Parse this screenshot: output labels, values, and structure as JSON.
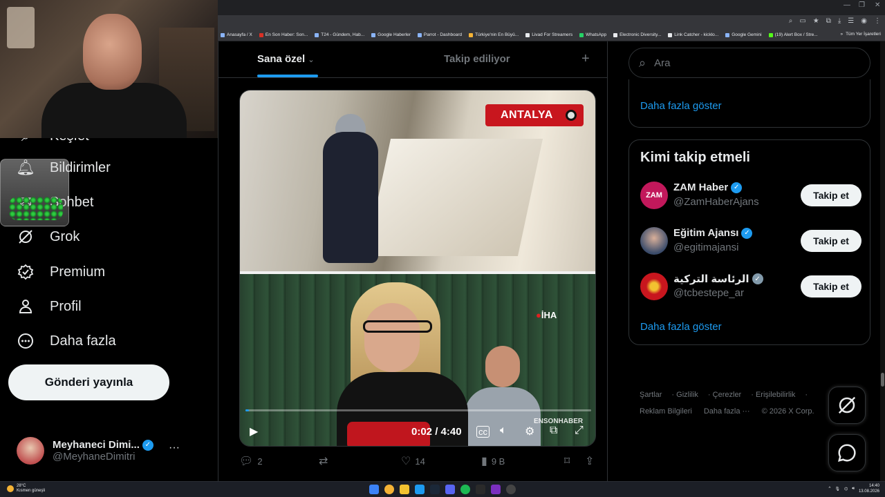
{
  "browser": {
    "bookmarks": [
      "Anasayfa / X",
      "En Son Haber: Son...",
      "T24 - Gündem, Hab...",
      "Google Haberler",
      "Parrot - Dashboard",
      "Türkiye'nin En Büyü...",
      "Livad For Streamers",
      "WhatsApp",
      "Electronic Diversity...",
      "Link Catcher - kicklo...",
      "Google Gemini",
      "(19) Alert Box / Stre..."
    ],
    "bookmarks_overflow": "»",
    "all_bookmarks": "Tüm Yer İşaretleri"
  },
  "nav": {
    "items": [
      {
        "label": "Keşfet",
        "icon": "search-icon"
      },
      {
        "label": "Bildirimler",
        "icon": "bell-icon"
      },
      {
        "label": "Sohbet",
        "icon": "chat-icon"
      },
      {
        "label": "Grok",
        "icon": "grok-icon"
      },
      {
        "label": "Premium",
        "icon": "premium-icon"
      },
      {
        "label": "Profil",
        "icon": "person-icon"
      },
      {
        "label": "Daha fazla",
        "icon": "more-circle-icon"
      }
    ],
    "post_button": "Gönderi yayınla"
  },
  "profile": {
    "name": "Meyhaneci Dimi...",
    "handle": "@MeyhaneDimitri",
    "more": "···"
  },
  "timeline": {
    "tab_for_you": "Sana özel",
    "tab_following": "Takip ediliyor",
    "plus": "+"
  },
  "video": {
    "location_badge": "ANTALYA",
    "agency_logo": "İHA",
    "source_tag": "ENSONHABER",
    "time": "0:02 / 4:40",
    "progress": 0.01
  },
  "post_actions": {
    "replies": "2",
    "reposts": "",
    "likes": "14",
    "views": "9 B"
  },
  "sidebar": {
    "search_placeholder": "Ara",
    "show_more": "Daha fazla göster",
    "who_to_follow_title": "Kimi takip etmeli",
    "follow_label": "Takip et",
    "accounts": [
      {
        "name": "ZAM Haber",
        "handle": "@ZamHaberAjans",
        "verified": "blue",
        "avatar_text": "ZAM"
      },
      {
        "name": "Eğitim Ajansı",
        "handle": "@egitimajansi",
        "verified": "blue",
        "avatar_text": ""
      },
      {
        "name": "الرئاسة التركية",
        "handle": "@tcbestepe_ar",
        "verified": "gray",
        "avatar_text": ""
      }
    ],
    "show_more_2": "Daha fazla göster"
  },
  "footer": {
    "links": [
      "Şartlar",
      "Gizlilik",
      "Çerezler",
      "Erişilebilirlik",
      "Reklam Bilgileri",
      "Daha fazla ···"
    ],
    "copyright": "© 2026 X Corp."
  },
  "taskbar": {
    "temp": "28°C",
    "weather": "Kısmen güneşli",
    "time": "14:40",
    "date": "13.08.2026"
  },
  "colors": {
    "accent": "#1d9bf0",
    "badge_red": "#c8161e",
    "background": "#000000"
  }
}
